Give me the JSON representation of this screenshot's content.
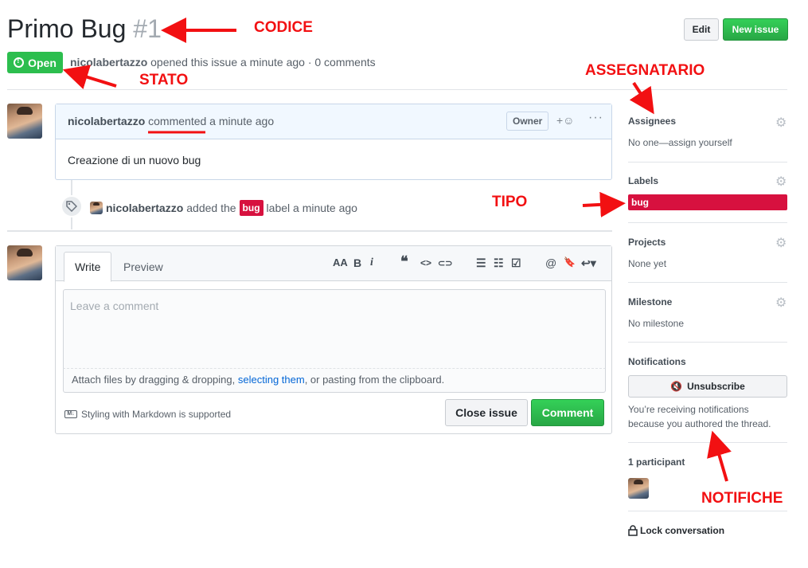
{
  "header": {
    "title": "Primo Bug",
    "number": "#1",
    "edit_label": "Edit",
    "new_issue_label": "New issue"
  },
  "state": {
    "label": "Open",
    "author": "nicolabertazzo",
    "meta_text": " opened this issue a minute ago · 0 comments"
  },
  "comment": {
    "author": "nicolabertazzo",
    "action": "commented",
    "time": " a minute ago",
    "badge": "Owner",
    "reaction": "+☺",
    "more": "···",
    "body": "Creazione di un nuovo bug"
  },
  "event": {
    "author": "nicolabertazzo",
    "pre": "added the",
    "label": "bug",
    "post": "label a minute ago"
  },
  "editor": {
    "tab_write": "Write",
    "tab_preview": "Preview",
    "placeholder": "Leave a comment",
    "attach_pre": "Attach files by dragging & dropping, ",
    "attach_link": "selecting them",
    "attach_post": ", or pasting from the clipboard.",
    "markdown_note": "Styling with Markdown is supported",
    "markdown_icon": "M↓",
    "close_label": "Close issue",
    "comment_label": "Comment",
    "tools": {
      "heading": "AA",
      "bold": "B",
      "italic": "i",
      "quote": "❝",
      "code": "<>",
      "link": "⊂⊃",
      "ul": "☰",
      "ol": "☷",
      "task": "☑",
      "mention": "@",
      "ref": "🔖",
      "reply": "↩▾"
    }
  },
  "sidebar": {
    "assignees_title": "Assignees",
    "assignees_value": "No one—assign yourself",
    "labels_title": "Labels",
    "labels_value": "bug",
    "projects_title": "Projects",
    "projects_value": "None yet",
    "milestone_title": "Milestone",
    "milestone_value": "No milestone",
    "notifications_title": "Notifications",
    "unsubscribe_label": "Unsubscribe",
    "notifications_line1": "You’re receiving notifications",
    "notifications_line2": "because you authored the thread.",
    "participants_title": "1 participant",
    "lock_label": "Lock conversation"
  },
  "annotations": {
    "codice": "CODICE",
    "stato": "STATO",
    "assegnatario": "ASSEGNATARIO",
    "tipo": "TIPO",
    "notifiche": "NOTIFICHE"
  },
  "colors": {
    "green": "#2cbe4e",
    "label_red": "#d7113f",
    "annotation_red": "#f21012",
    "link_blue": "#0366d6"
  }
}
